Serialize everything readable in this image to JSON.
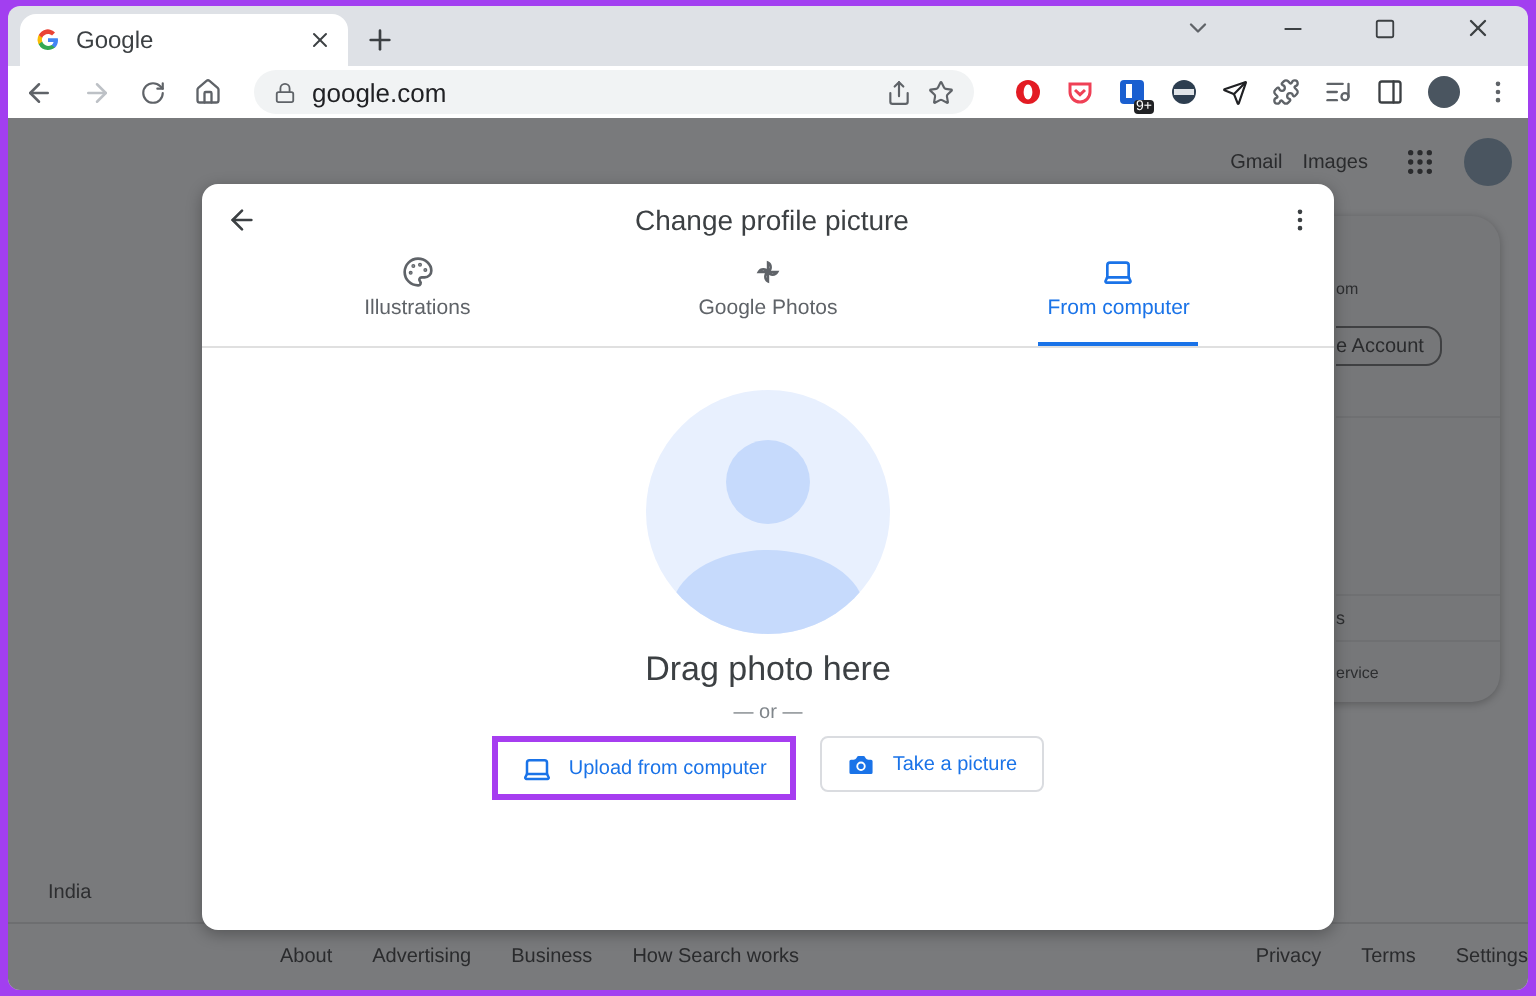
{
  "browser": {
    "tab": {
      "title": "Google"
    },
    "address": "google.com",
    "extension_badge": "9+"
  },
  "page": {
    "header_links": [
      "Gmail",
      "Images"
    ],
    "account_card": {
      "email_fragment": "om",
      "button": "e Account",
      "item_1": "s",
      "item_2": "ervice"
    },
    "footer": {
      "country": "India",
      "links_left": [
        "About",
        "Advertising",
        "Business",
        "How Search works"
      ],
      "links_right": [
        "Privacy",
        "Terms",
        "Settings"
      ]
    }
  },
  "dialog": {
    "title": "Change profile picture",
    "tabs": [
      {
        "label": "Illustrations",
        "kind": "palette",
        "selected": false
      },
      {
        "label": "Google Photos",
        "kind": "pinwheel",
        "selected": false
      },
      {
        "label": "From computer",
        "kind": "laptop",
        "selected": true
      }
    ],
    "prompt": "Drag photo here",
    "separator": "— or —",
    "buttons": [
      {
        "label": "Upload from computer",
        "kind": "laptop",
        "highlighted": true
      },
      {
        "label": "Take a picture",
        "kind": "camera",
        "highlighted": false
      }
    ]
  }
}
